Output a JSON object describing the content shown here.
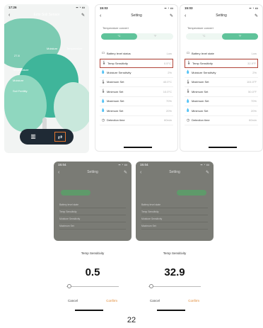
{
  "home": {
    "time": "17:26",
    "title": "Ecto Soil Sensor",
    "col_moisture": "Moisture",
    "col_temperature": "Temperature",
    "value_left": "27.8",
    "rows": [
      "Temperature",
      "Moisture",
      "Soil Fertility"
    ],
    "accent": "#3fb59a",
    "active_outline": "#e2762f"
  },
  "settings_a": {
    "time": "15:03",
    "title": "Setting",
    "unit_label": "Temperature convert",
    "toggle": [
      "°C",
      "°F"
    ],
    "items": [
      {
        "icon": "battery-icon",
        "label": "Battery level status",
        "value": "Low"
      },
      {
        "icon": "thermometer-icon",
        "label": "Temp Sensitivity",
        "value": "0.5°C"
      },
      {
        "icon": "droplet-icon",
        "label": "Moisture Sensitivity",
        "value": "2%"
      },
      {
        "icon": "thermometer-icon",
        "label": "Maximum Set",
        "value": "40.0°C"
      },
      {
        "icon": "thermometer-icon",
        "label": "Minimum Set",
        "value": "10.0°C"
      },
      {
        "icon": "droplet-icon",
        "label": "Maximum Set",
        "value": "70%"
      },
      {
        "icon": "droplet-icon",
        "label": "Minimum Set",
        "value": "20%"
      },
      {
        "icon": "clock-icon",
        "label": "Detection time",
        "value": "60min"
      }
    ]
  },
  "settings_b": {
    "time": "15:03",
    "title": "Setting",
    "unit_label": "Temperature convert",
    "toggle": [
      "°C",
      "°F"
    ],
    "items": [
      {
        "icon": "battery-icon",
        "label": "Battery level state",
        "value": "Low"
      },
      {
        "icon": "thermometer-icon",
        "label": "Temp Sensitivity",
        "value": "32.9°F"
      },
      {
        "icon": "droplet-icon",
        "label": "Moisture Sensitivity",
        "value": "2%"
      },
      {
        "icon": "thermometer-icon",
        "label": "Maximum Set",
        "value": "104.0°F"
      },
      {
        "icon": "thermometer-icon",
        "label": "Minimum Set",
        "value": "50.0°F"
      },
      {
        "icon": "droplet-icon",
        "label": "Maximum Set",
        "value": "70%"
      },
      {
        "icon": "droplet-icon",
        "label": "Minimum Set",
        "value": "20%"
      },
      {
        "icon": "clock-icon",
        "label": "Detection time",
        "value": "60min"
      }
    ]
  },
  "dark_a": {
    "time": "15:04",
    "title": "Setting",
    "items": [
      "Battery level state",
      "Temp Sensitivity",
      "Moisture Sensitivity",
      "Maximum Set"
    ]
  },
  "dark_b": {
    "time": "15:04",
    "title": "Setting",
    "items": [
      "Battery level state",
      "Temp Sensitivity",
      "Moisture Sensitivity",
      "Maximum Set"
    ]
  },
  "picker_a": {
    "title": "Temp Sensitivity",
    "value": "0.5",
    "slider_position": 0.05,
    "cancel": "Cancel",
    "confirm": "Confirm"
  },
  "picker_b": {
    "title": "Temp Sensitivity",
    "value": "32.9",
    "slider_position": 0.05,
    "cancel": "Cancel",
    "confirm": "Confirm"
  },
  "page_number": "22"
}
